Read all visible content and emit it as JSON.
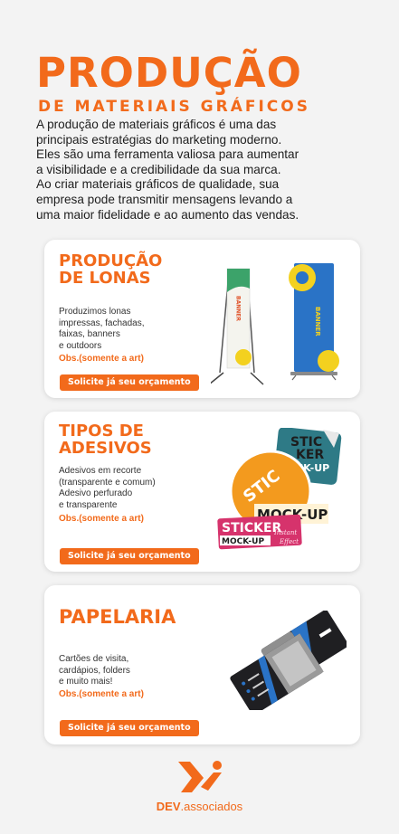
{
  "hero": {
    "title": "PRODUÇÃO",
    "subtitle": "DE MATERIAIS GRÁFICOS",
    "paragraph_1": "A produção de materiais gráficos é uma das\nprincipais estratégias do marketing moderno.\nEles são uma ferramenta valiosa para aumentar\na visibilidade e a credibilidade da sua marca.",
    "paragraph_2": " Ao criar materiais gráficos de qualidade, sua\nempresa pode transmitir mensagens levando a\numa maior fidelidade e ao aumento das vendas."
  },
  "cards": [
    {
      "title": "PRODUÇÃO\nDE LONAS",
      "description": "Produzimos lonas\nimpressas, fachadas,\nfaixas, banners\ne outdoors",
      "obs": "Obs.(somente a art)",
      "cta": "Solicite já seu orçamento",
      "banner_text": "BANNER"
    },
    {
      "title": "TIPOS DE\nADESIVOS",
      "description": "Adesivos em recorte\n(transparente e comum)\nAdesivo perfurado\ne transparente",
      "obs": "Obs.(somente a art)",
      "cta": "Solicite já seu orçamento",
      "sticker_words": [
        "STIC",
        "KER",
        "CK-UP",
        "STIC",
        "MOCK-UP",
        "STICKER",
        "MOCK-UP",
        "Instant",
        "Effect"
      ]
    },
    {
      "title": "PAPELARIA",
      "description": "Cartões de visita,\ncardápios, folders\ne muito mais!",
      "obs": "Obs.(somente a art)",
      "cta": "Solicite já seu orçamento"
    }
  ],
  "footer": {
    "brand_bold": "DEV",
    "brand_rest": ".associados"
  },
  "colors": {
    "accent": "#f26a1b",
    "banner_blue": "#2a73c6",
    "banner_yellow": "#f3d11f",
    "sticker_teal": "#2e7a86",
    "sticker_pink": "#d6336c",
    "card_dark": "#1f1f22"
  }
}
